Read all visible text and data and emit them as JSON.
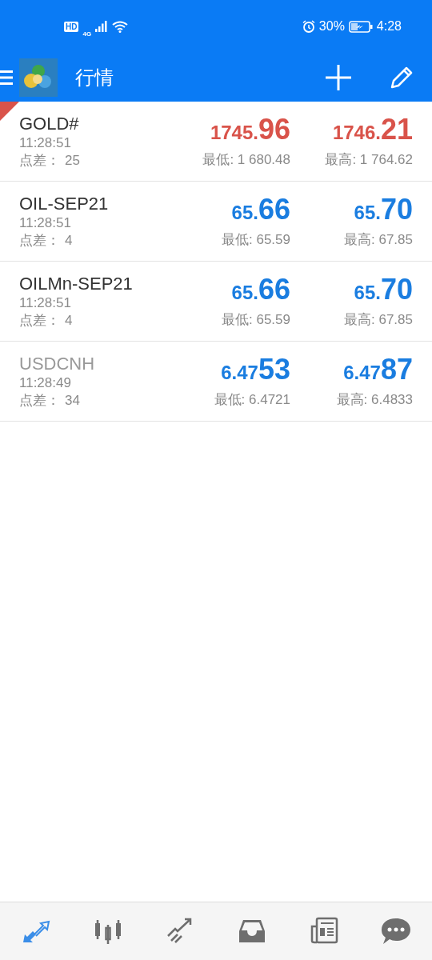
{
  "status_bar": {
    "network_badge": "HD",
    "network_type": "4G",
    "battery_percent": "30%",
    "time": "4:28"
  },
  "header": {
    "title": "行情"
  },
  "quotes": [
    {
      "symbol": "GOLD#",
      "time": "11:28:51",
      "spread_label": "点差：",
      "spread": "25",
      "color": "#d9534a",
      "flagged": true,
      "dimmed": false,
      "bid_head": "1745.",
      "bid_tail": "96",
      "ask_head": "1746.",
      "ask_tail": "21",
      "low": "最低: 1 680.48",
      "high": "最高: 1 764.62"
    },
    {
      "symbol": "OIL-SEP21",
      "time": "11:28:51",
      "spread_label": "点差：",
      "spread": "4",
      "color": "#1a7de0",
      "flagged": false,
      "dimmed": false,
      "bid_head": "65.",
      "bid_tail": "66",
      "ask_head": "65.",
      "ask_tail": "70",
      "low": "最低: 65.59",
      "high": "最高: 67.85"
    },
    {
      "symbol": "OILMn-SEP21",
      "time": "11:28:51",
      "spread_label": "点差：",
      "spread": "4",
      "color": "#1a7de0",
      "flagged": false,
      "dimmed": false,
      "bid_head": "65.",
      "bid_tail": "66",
      "ask_head": "65.",
      "ask_tail": "70",
      "low": "最低: 65.59",
      "high": "最高: 67.85"
    },
    {
      "symbol": "USDCNH",
      "time": "11:28:49",
      "spread_label": "点差：",
      "spread": "34",
      "color": "#1a7de0",
      "flagged": false,
      "dimmed": true,
      "bid_head": "6.47",
      "bid_tail": "53",
      "ask_head": "6.47",
      "ask_tail": "87",
      "low": "最低: 6.4721",
      "high": "最高: 6.4833"
    }
  ],
  "bottom_nav": [
    {
      "kind": "quotes",
      "selected": true
    },
    {
      "kind": "chart",
      "selected": false
    },
    {
      "kind": "trade",
      "selected": false
    },
    {
      "kind": "history",
      "selected": false
    },
    {
      "kind": "news",
      "selected": false
    },
    {
      "kind": "chat",
      "selected": false
    }
  ]
}
